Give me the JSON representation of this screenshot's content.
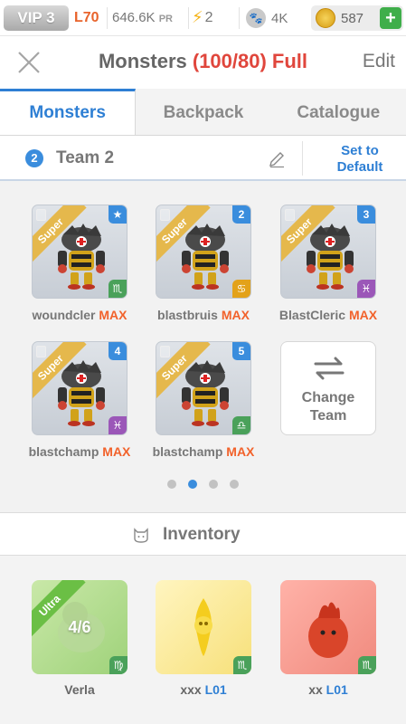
{
  "status": {
    "vip": "VIP 3",
    "level": "L70",
    "power": "646.6K",
    "power_unit": "PR",
    "energy": "2",
    "food": "4K",
    "coins": "587",
    "add": "+"
  },
  "header": {
    "title": "Monsters",
    "count": "(100/80) Full",
    "edit": "Edit"
  },
  "tabs": [
    {
      "label": "Monsters",
      "active": true
    },
    {
      "label": "Backpack",
      "active": false
    },
    {
      "label": "Catalogue",
      "active": false
    }
  ],
  "team": {
    "number": "2",
    "name": "Team 2",
    "set_default_line1": "Set to",
    "set_default_line2": "Default"
  },
  "team_monsters": [
    {
      "name": "woundcler",
      "badge": "MAX",
      "rank": "Super",
      "slot": "★",
      "zodiac": "♏"
    },
    {
      "name": "blastbruis",
      "badge": "MAX",
      "rank": "Super",
      "slot": "2",
      "zodiac": "♋"
    },
    {
      "name": "BlastCleric",
      "badge": "MAX",
      "rank": "Super",
      "slot": "3",
      "zodiac": "♓"
    },
    {
      "name": "blastchamp",
      "badge": "MAX",
      "rank": "Super",
      "slot": "4",
      "zodiac": "♓"
    },
    {
      "name": "blastchamp",
      "badge": "MAX",
      "rank": "Super",
      "slot": "5",
      "zodiac": "♎"
    }
  ],
  "change_team": {
    "line1": "Change",
    "line2": "Team"
  },
  "pager": {
    "pages": 4,
    "current": 2
  },
  "inventory": {
    "title": "Inventory",
    "items": [
      {
        "name": "Verla",
        "level": "",
        "rank": "Ultra",
        "progress": "4/6",
        "zodiac": "♍"
      },
      {
        "name": "xxx",
        "level": "L01",
        "rank": "",
        "progress": "",
        "zodiac": "♏"
      },
      {
        "name": "xx",
        "level": "L01",
        "rank": "",
        "progress": "",
        "zodiac": "♏"
      }
    ]
  },
  "colors": {
    "accent": "#2e7fd4",
    "alert": "#e0463c",
    "max": "#f2622b",
    "super": "#e5b84c",
    "ultra": "#6bbf45"
  }
}
